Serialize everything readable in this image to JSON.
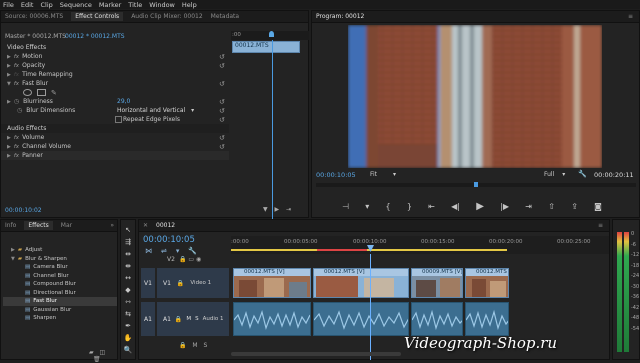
{
  "menu": [
    "File",
    "Edit",
    "Clip",
    "Sequence",
    "Marker",
    "Title",
    "Window",
    "Help"
  ],
  "source_panel": {
    "tabs": [
      "Source: 00006.MTS",
      "Effect Controls",
      "Audio Clip Mixer: 00012",
      "Metadata"
    ],
    "master_label": "Master * 00012.MTS",
    "clip_label": "00012 * 00012.MTS",
    "clip_name": "00012.MTS",
    "video_effects_header": "Video Effects",
    "rows": [
      {
        "type": "fx",
        "label": "Motion"
      },
      {
        "type": "fx",
        "label": "Opacity"
      },
      {
        "type": "plain",
        "label": "Time Remapping"
      },
      {
        "type": "fx",
        "label": "Fast Blur"
      },
      {
        "type": "param",
        "label": "Blurriness",
        "value": "29,0"
      },
      {
        "type": "param",
        "label": "Blur Dimensions",
        "value": "Horizontal and Vertical"
      },
      {
        "type": "param",
        "label": "",
        "value": "Repeat Edge Pixels"
      }
    ],
    "audio_effects_header": "Audio Effects",
    "audio_rows": [
      "Volume",
      "Channel Volume",
      "Panner"
    ],
    "timecode": "00:00:10:02",
    "ruler_start": ":00"
  },
  "program_monitor": {
    "title": "Program: 00012",
    "timecode_left": "00:00:10:05",
    "fit": "Fit",
    "quality": "Full",
    "timecode_right": "00:00:20:11"
  },
  "project_panel": {
    "tabs": [
      "Info",
      "Effects",
      "Mar"
    ],
    "items": [
      {
        "label": "Adjust",
        "level": 1,
        "folder": true
      },
      {
        "label": "Blur & Sharpen",
        "level": 1,
        "folder": true,
        "open": true
      },
      {
        "label": "Camera Blur",
        "level": 2
      },
      {
        "label": "Channel Blur",
        "level": 2
      },
      {
        "label": "Compound Blur",
        "level": 2
      },
      {
        "label": "Directional Blur",
        "level": 2
      },
      {
        "label": "Fast Blur",
        "level": 2,
        "selected": true
      },
      {
        "label": "Gaussian Blur",
        "level": 2
      },
      {
        "label": "Sharpen",
        "level": 2
      }
    ]
  },
  "timeline": {
    "sequence_tab": "00012",
    "timecode": "00:00:10:05",
    "ruler": [
      ":00:00",
      "00:00:05:00",
      "00:00:10:00",
      "00:00:15:00",
      "00:00:20:00",
      "00:00:25:00"
    ],
    "tracks": {
      "v2": "V2",
      "v1_src": "V1",
      "v1": "V1",
      "v1_name": "Video 1",
      "a1_src": "A1",
      "a1": "A1",
      "a1_name": "Audio 1",
      "mute": "M",
      "solo": "S"
    },
    "video_clips": [
      "00012.MTS [V]",
      "00012.MTS [V]",
      "00009.MTS [V]",
      "00012.MTS [V]"
    ],
    "audio_levels": [
      "0",
      "-6",
      "-12",
      "-18",
      "-24",
      "-30",
      "-36",
      "-42",
      "-48",
      "-54"
    ]
  },
  "watermark": "Videograph-Shop.ru",
  "colors": {
    "accent": "#5aa8e6",
    "playhead": "#6ab0ff",
    "clip_video": "#8ab2d6",
    "clip_audio": "#3c6e90"
  }
}
